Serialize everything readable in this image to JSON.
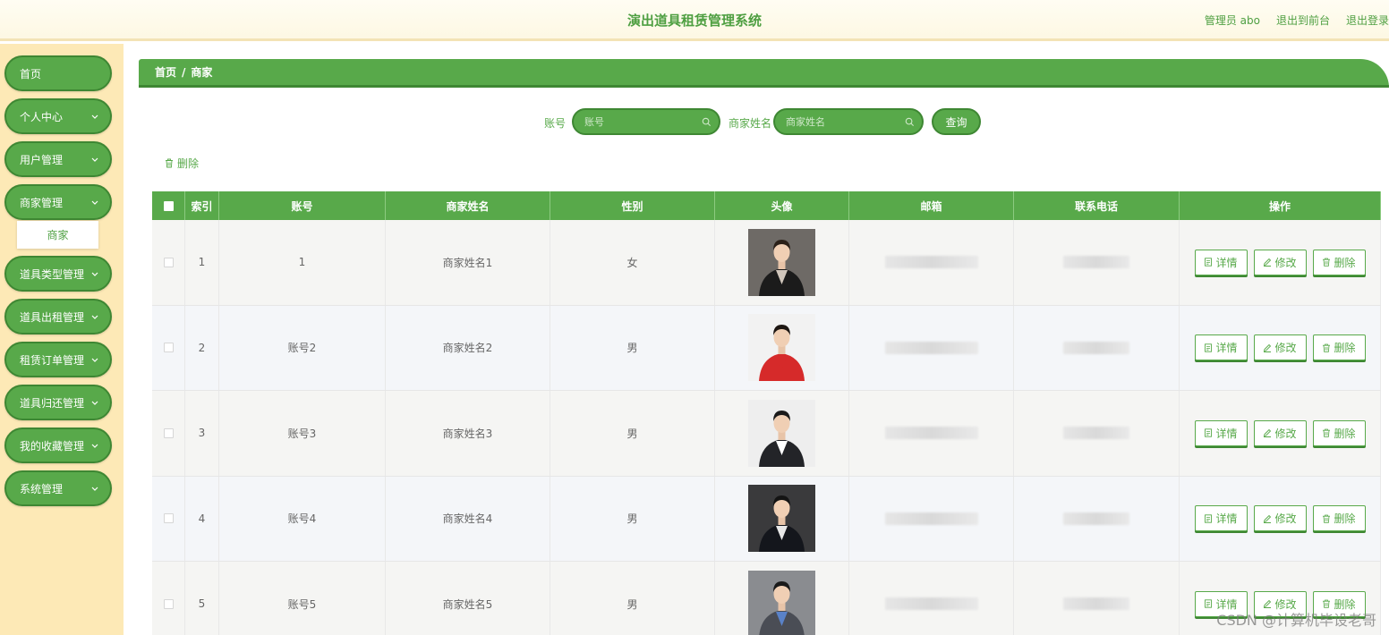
{
  "header": {
    "title": "演出道具租赁管理系统",
    "user": "管理员 abo",
    "back_front": "退出到前台",
    "logout": "退出登录"
  },
  "sidebar": {
    "items": [
      {
        "label": "首页"
      },
      {
        "label": "个人中心"
      },
      {
        "label": "用户管理"
      },
      {
        "label": "商家管理"
      },
      {
        "label": "道具类型管理"
      },
      {
        "label": "道具出租管理"
      },
      {
        "label": "租赁订单管理"
      },
      {
        "label": "道具归还管理"
      },
      {
        "label": "我的收藏管理"
      },
      {
        "label": "系统管理"
      }
    ],
    "submenu": "商家"
  },
  "breadcrumb": {
    "home": "首页",
    "sep": "/",
    "current": "商家"
  },
  "search": {
    "account_label": "账号",
    "account_placeholder": "账号",
    "name_label": "商家姓名",
    "name_placeholder": "商家姓名",
    "query_button": "查询"
  },
  "toolbar": {
    "delete_label": "删除"
  },
  "table": {
    "headers": {
      "index": "索引",
      "account": "账号",
      "name": "商家姓名",
      "gender": "性别",
      "avatar": "头像",
      "email": "邮箱",
      "phone": "联系电话",
      "actions": "操作"
    },
    "rows": [
      {
        "index": "1",
        "account": "1",
        "name": "商家姓名1",
        "gender": "女"
      },
      {
        "index": "2",
        "account": "账号2",
        "name": "商家姓名2",
        "gender": "男"
      },
      {
        "index": "3",
        "account": "账号3",
        "name": "商家姓名3",
        "gender": "男"
      },
      {
        "index": "4",
        "account": "账号4",
        "name": "商家姓名4",
        "gender": "男"
      },
      {
        "index": "5",
        "account": "账号5",
        "name": "商家姓名5",
        "gender": "男"
      }
    ],
    "actions": {
      "detail": "详情",
      "edit": "修改",
      "delete": "删除"
    }
  },
  "watermark": "CSDN @计算机毕设老哥",
  "colors": {
    "primary": "#58a94a",
    "primary_dark": "#3e8733",
    "sidebar_bg": "#fde9b6",
    "header_bg": "#fdf8e3"
  }
}
